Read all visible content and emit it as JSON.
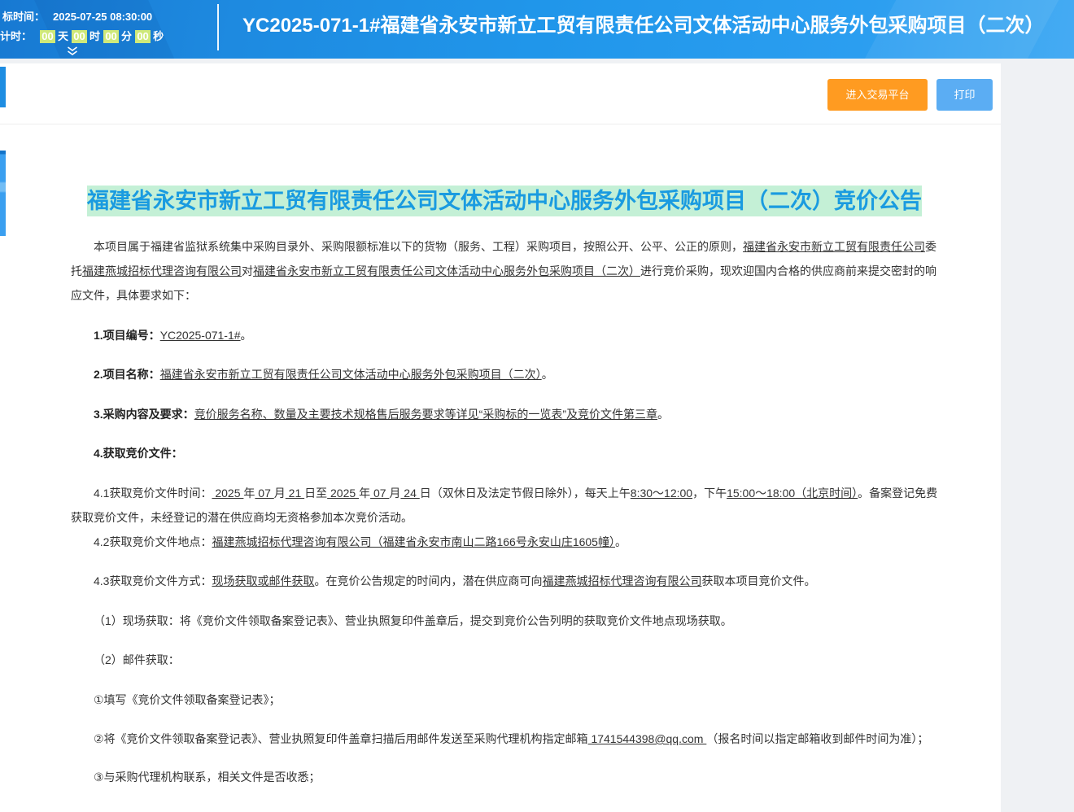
{
  "header": {
    "open_time_label": "标时间：",
    "open_time_value": "2025-07-25 08:30:00",
    "countdown_label": "计时：",
    "countdown": [
      {
        "value": "00",
        "unit": "天"
      },
      {
        "value": "00",
        "unit": "时"
      },
      {
        "value": "00",
        "unit": "分"
      },
      {
        "value": "00",
        "unit": "秒"
      }
    ],
    "project_title": "YC2025-071-1#福建省永安市新立工贸有限责任公司文体活动中心服务外包采购项目（二次）"
  },
  "icons": {
    "header_expand": "chevron-double-down-icon"
  },
  "toolbar": {
    "enter_platform_label": "进入交易平台",
    "print_label": "打印"
  },
  "notice": {
    "title": "福建省永安市新立工贸有限责任公司文体活动中心服务外包采购项目（二次）竞价公告",
    "paragraphs": [
      [
        {
          "t": "本项目属于福建省监狱系统集中采购目录外、采购限额标准以下的货物（服务、工程）采购项目，按照公开、公平、公正的原则，"
        },
        {
          "u": "福建省永安市新立工贸有限责任公司"
        },
        {
          "t": "委托"
        },
        {
          "u": "福建燕城招标代理咨询有限公司"
        },
        {
          "t": "对"
        },
        {
          "u": "福建省永安市新立工贸有限责任公司文体活动中心服务外包采购项目（二次）"
        },
        {
          "t": "进行竞价采购，现欢迎国内合格的供应商前来提交密封的响应文件，具体要求如下："
        }
      ],
      [
        {
          "b": "1.项目编号："
        },
        {
          "u": "YC2025-071-1#"
        },
        {
          "t": "。"
        }
      ],
      [
        {
          "b": "2.项目名称："
        },
        {
          "u": "福建省永安市新立工贸有限责任公司文体活动中心服务外包采购项目（二次）"
        },
        {
          "t": "。"
        }
      ],
      [
        {
          "b": "3.采购内容及要求："
        },
        {
          "u": "竞价服务名称、数量及主要技术规格售后服务要求等详见“采购标的一览表”及竞价文件第三章"
        },
        {
          "t": "。"
        }
      ],
      [
        {
          "b": "4.获取竞价文件："
        }
      ],
      [
        {
          "t": "4.1获取竞价文件时间："
        },
        {
          "u": " 2025 "
        },
        {
          "t": "年"
        },
        {
          "u": " 07 "
        },
        {
          "t": "月"
        },
        {
          "u": " 21 "
        },
        {
          "t": "日至"
        },
        {
          "u": " 2025 "
        },
        {
          "t": "年"
        },
        {
          "u": " 07 "
        },
        {
          "t": "月"
        },
        {
          "u": " 24 "
        },
        {
          "t": "日（双休日及法定节假日除外），每天上午"
        },
        {
          "u": "8:30～12:00"
        },
        {
          "t": "，下午"
        },
        {
          "u": "15:00～18:00（北京时间）"
        },
        {
          "t": "。备案登记免费获取竞价文件，未经登记的潜在供应商均无资格参加本次竞价活动。"
        }
      ],
      [
        {
          "t": "4.2获取竞价文件地点："
        },
        {
          "u": "福建燕城招标代理咨询有限公司（福建省永安市南山二路166号永安山庄1605幢）"
        },
        {
          "t": "。"
        }
      ],
      [
        {
          "t": "4.3获取竞价文件方式："
        },
        {
          "u": "现场获取或邮件获取"
        },
        {
          "t": "。在竞价公告规定的时间内，潜在供应商可向"
        },
        {
          "u": "福建燕城招标代理咨询有限公司"
        },
        {
          "t": "获取本项目竞价文件。"
        }
      ],
      [
        {
          "t": "（1）现场获取：将《竞价文件领取备案登记表》、营业执照复印件盖章后，提交到竞价公告列明的获取竞价文件地点现场获取。"
        }
      ],
      [
        {
          "t": "（2）邮件获取："
        }
      ],
      [
        {
          "t": "①填写《竞价文件领取备案登记表》；"
        }
      ],
      [
        {
          "t": "②将《竞价文件领取备案登记表》、营业执照复印件盖章扫描后用邮件发送至采购代理机构指定邮箱"
        },
        {
          "u": " 1741544398@qq.com "
        },
        {
          "t": "（报名时间以指定邮箱收到邮件时间为准）；"
        }
      ],
      [
        {
          "t": "③与采购代理机构联系，相关文件是否收悉；"
        }
      ]
    ]
  },
  "colors": {
    "header_blue": "#2096ea",
    "title_text": "#1a9be0",
    "title_highlight": "#c4f0d6",
    "enter_button": "#ff9b21",
    "print_button": "#5badf3",
    "countdown_box": "#cfe97a"
  }
}
